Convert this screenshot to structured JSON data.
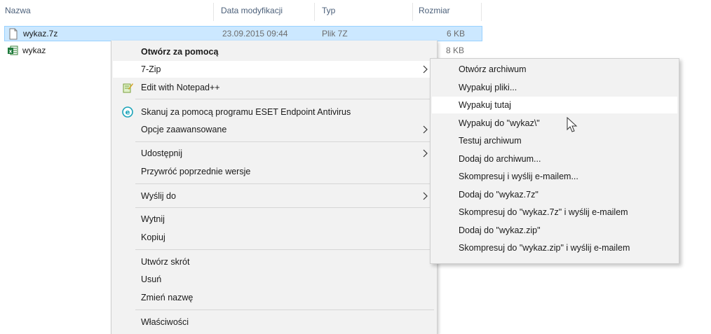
{
  "explorer": {
    "columns": {
      "name": "Nazwa",
      "date": "Data modyfikacji",
      "type": "Typ",
      "size": "Rozmiar"
    },
    "files": [
      {
        "name": "wykaz.7z",
        "date": "23.09.2015 09:44",
        "type": "Plik 7Z",
        "size": "6 KB",
        "icon": "document-icon",
        "selected": true
      },
      {
        "name": "wykaz",
        "date": "",
        "type": "",
        "size": "8 KB",
        "icon": "excel-icon",
        "selected": false
      }
    ]
  },
  "context_menu": {
    "items": [
      {
        "label": "Otwórz za pomocą",
        "bold": true
      },
      {
        "label": "7-Zip",
        "submenu": true,
        "highlighted": true
      },
      {
        "label": "Edit with Notepad++",
        "icon": "notepad-plus-plus-icon"
      },
      {
        "label": "Skanuj za pomocą programu ESET Endpoint Antivirus",
        "icon": "eset-icon"
      },
      {
        "label": "Opcje zaawansowane",
        "submenu": true
      },
      {
        "label": "Udostępnij",
        "submenu": true
      },
      {
        "label": "Przywróć poprzednie wersje"
      },
      {
        "label": "Wyślij do",
        "submenu": true
      },
      {
        "label": "Wytnij"
      },
      {
        "label": "Kopiuj"
      },
      {
        "label": "Utwórz skrót"
      },
      {
        "label": "Usuń"
      },
      {
        "label": "Zmień nazwę"
      },
      {
        "label": "Właściwości"
      }
    ]
  },
  "sevenzip_submenu": {
    "items": [
      {
        "label": "Otwórz archiwum"
      },
      {
        "label": "Wypakuj pliki..."
      },
      {
        "label": "Wypakuj tutaj",
        "hover": true
      },
      {
        "label": "Wypakuj do \"wykaz\\\""
      },
      {
        "label": "Testuj archiwum"
      },
      {
        "label": "Dodaj do archiwum..."
      },
      {
        "label": "Skompresuj i wyślij e-mailem..."
      },
      {
        "label": "Dodaj do \"wykaz.7z\""
      },
      {
        "label": "Skompresuj do \"wykaz.7z\" i wyślij e-mailem"
      },
      {
        "label": "Dodaj do \"wykaz.zip\""
      },
      {
        "label": "Skompresuj do \"wykaz.zip\" i wyślij e-mailem"
      }
    ]
  },
  "colors": {
    "selection_bg": "#cce8ff",
    "selection_border": "#99d1ff",
    "menu_bg": "#f2f2f2",
    "menu_highlight": "#ffffff",
    "header_text": "#4c607a"
  }
}
